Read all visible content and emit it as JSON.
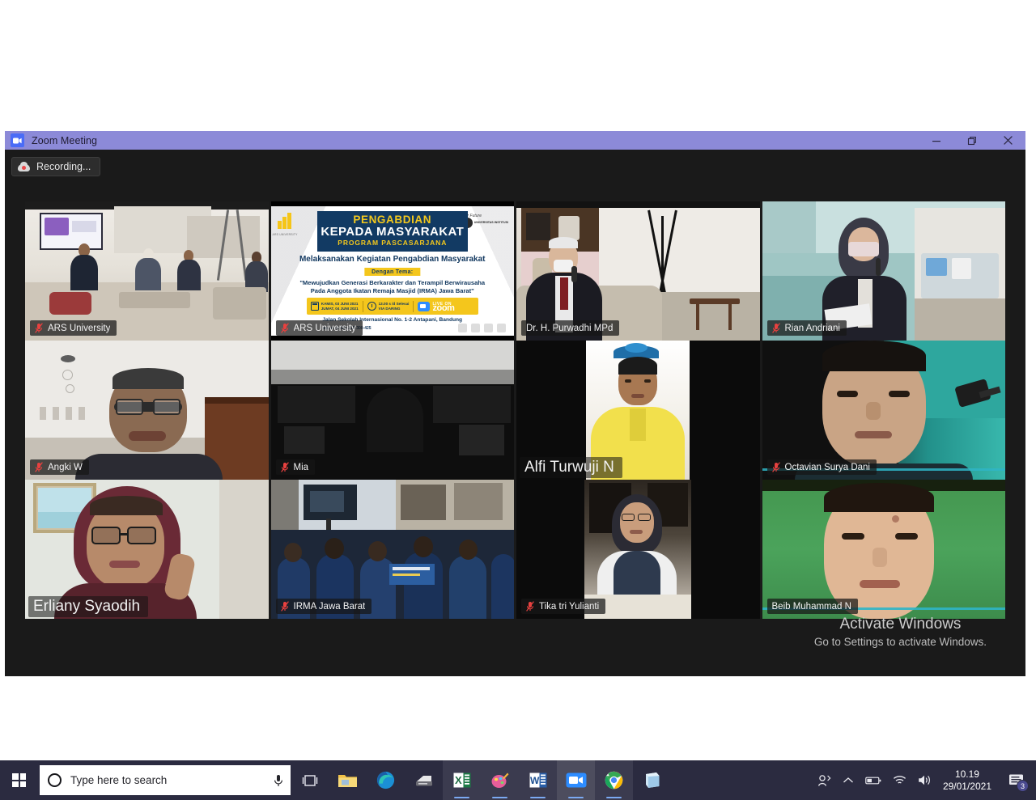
{
  "window": {
    "title": "Zoom Meeting",
    "icon": "zoom-camera-icon",
    "controls": {
      "minimize": "minimize-icon",
      "restore": "restore-icon",
      "close": "close-icon"
    }
  },
  "toolbar": {
    "recording_label": "Recording...",
    "recording_icon": "cloud-recording-icon"
  },
  "grid": {
    "rows": 3,
    "cols": 4,
    "active_speaker_border_color": "#c9e265",
    "tiles": [
      {
        "id": "t1",
        "name": "ARS University",
        "muted": true,
        "active": false,
        "large_label": false
      },
      {
        "id": "t2",
        "name": "ARS University",
        "muted": true,
        "active": false,
        "large_label": false
      },
      {
        "id": "t3",
        "name": "Dr. H. Purwadhi MPd",
        "muted": false,
        "active": true,
        "large_label": false
      },
      {
        "id": "t4",
        "name": "Rian Andriani",
        "muted": true,
        "active": false,
        "large_label": false
      },
      {
        "id": "t5",
        "name": "Angki W",
        "muted": true,
        "active": false,
        "large_label": false
      },
      {
        "id": "t6",
        "name": "Mia",
        "muted": true,
        "active": false,
        "large_label": false
      },
      {
        "id": "t7",
        "name": "Alfi Turwuji N",
        "muted": false,
        "active": false,
        "large_label": true
      },
      {
        "id": "t8",
        "name": "Octavian Surya Dani",
        "muted": true,
        "active": false,
        "large_label": false
      },
      {
        "id": "t9",
        "name": "Erliany Syaodih",
        "muted": false,
        "active": false,
        "large_label": true
      },
      {
        "id": "t10",
        "name": "IRMA Jawa Barat",
        "muted": true,
        "active": false,
        "large_label": false
      },
      {
        "id": "t11",
        "name": "Tika tri Yulianti",
        "muted": true,
        "active": false,
        "large_label": false
      },
      {
        "id": "t12",
        "name": "Beib Muhammad N",
        "muted": false,
        "active": false,
        "large_label": false
      }
    ]
  },
  "banner": {
    "title_line1": "PENGABDIAN",
    "title_line2": "KEPADA MASYARAKAT",
    "title_line3": "PROGRAM PASCASARJANA",
    "subtitle": "Melaksanakan Kegiatan Pengabdian Masyarakat",
    "theme_label": "Dengan Tema:",
    "theme_line1": "\"Mewujudkan Generasi  Berkarakter dan Terampil Berwirausaha",
    "theme_line2": "Pada Anggota Ikatan Remaja Masjid (IRMA) Jawa Barat\"",
    "date_line1": "KAMIS, 03 JUNI 2021",
    "date_line2": "JUMAT, 04 JUNI 2021",
    "time_line1": "13.00  s /d Selesai",
    "time_line2": "VIA DARING",
    "live_on": "LIVE ON",
    "platform": "zoom",
    "address": "Jalan Sekolah Internasional No. 1-2 Antapani, Bandung",
    "contact": "ars.ac.id    081-222-300-425",
    "handwriting": "Work Focused at Your Future",
    "institute": "UNIVERSITAS INSTITUSI",
    "colors": {
      "navy": "#123a63",
      "yellow": "#f4c61c",
      "zoom_blue": "#2d8cff"
    }
  },
  "watermark": {
    "title": "Activate Windows",
    "subtitle": "Go to Settings to activate Windows."
  },
  "taskbar": {
    "start_icon": "windows-start-icon",
    "search_placeholder": "Type here to search",
    "search_icon": "search-circle-icon",
    "mic_icon": "microphone-icon",
    "task_view_icon": "task-view-icon",
    "apps": [
      {
        "name": "file-explorer-icon",
        "label": "File Explorer",
        "running": false,
        "active": false
      },
      {
        "name": "microsoft-edge-icon",
        "label": "Microsoft Edge",
        "running": false,
        "active": false
      },
      {
        "name": "scanner-icon",
        "label": "Scanner",
        "running": false,
        "active": false
      },
      {
        "name": "excel-icon",
        "label": "Excel",
        "running": true,
        "active": false
      },
      {
        "name": "paint-3d-icon",
        "label": "Paint 3D",
        "running": true,
        "active": false
      },
      {
        "name": "word-icon",
        "label": "Word",
        "running": true,
        "active": false
      },
      {
        "name": "zoom-icon",
        "label": "Zoom",
        "running": true,
        "active": true
      },
      {
        "name": "chrome-icon",
        "label": "Google Chrome",
        "running": true,
        "active": false
      },
      {
        "name": "store-icon",
        "label": "Microsoft Store",
        "running": false,
        "active": false
      }
    ],
    "tray": {
      "people_icon": "people-share-icon",
      "chevron_icon": "chevron-up-icon",
      "battery_icon": "battery-icon",
      "network_icon": "wifi-icon",
      "volume_icon": "speaker-icon",
      "time": "10.19",
      "date": "29/01/2021",
      "action_center_icon": "action-center-icon",
      "notification_count": "3"
    }
  }
}
